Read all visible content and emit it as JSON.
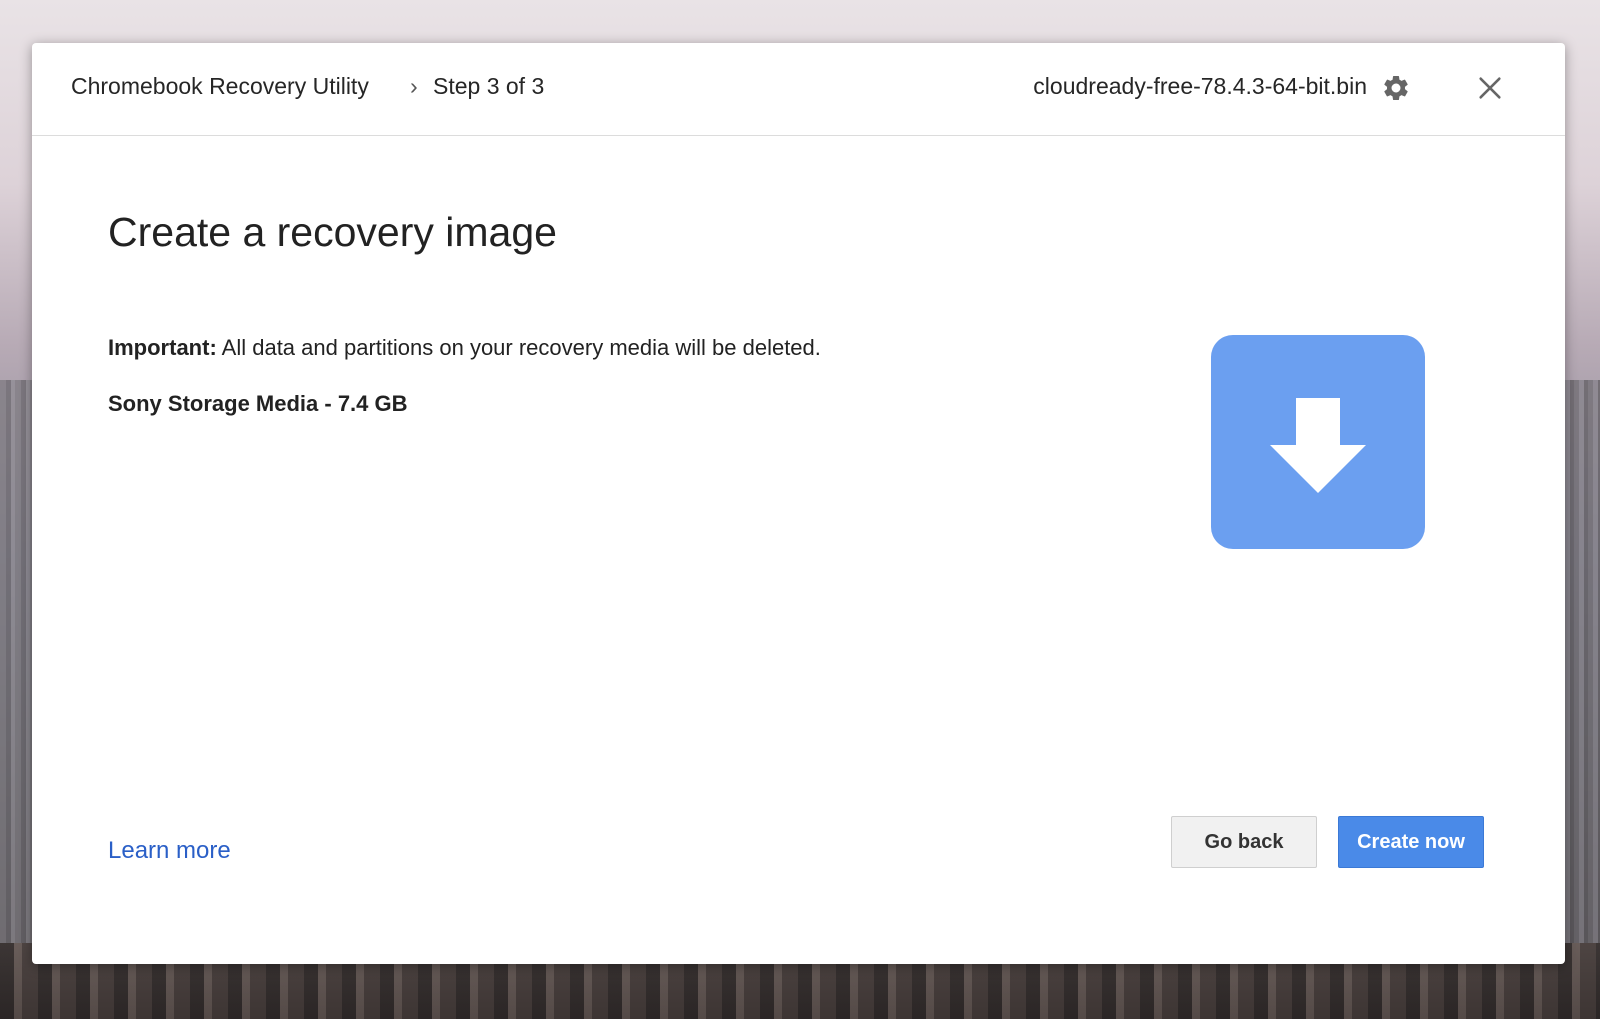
{
  "header": {
    "app_name": "Chromebook Recovery Utility",
    "separator": "›",
    "step": "Step 3 of 3",
    "file_name": "cloudready-free-78.4.3-64-bit.bin",
    "settings_icon": "gear-icon",
    "close_icon": "close-icon"
  },
  "main": {
    "title": "Create a recovery image",
    "warning_label": "Important:",
    "warning_text": " All data and partitions on your recovery media will be deleted.",
    "device": "Sony Storage Media - 7.4 GB",
    "tile_icon": "download-arrow-icon"
  },
  "footer": {
    "learn_more": "Learn more",
    "go_back": "Go back",
    "create_now": "Create now"
  },
  "colors": {
    "accent": "#4a8ae8",
    "tile": "#6b9ff0",
    "link": "#2a5fc7"
  }
}
